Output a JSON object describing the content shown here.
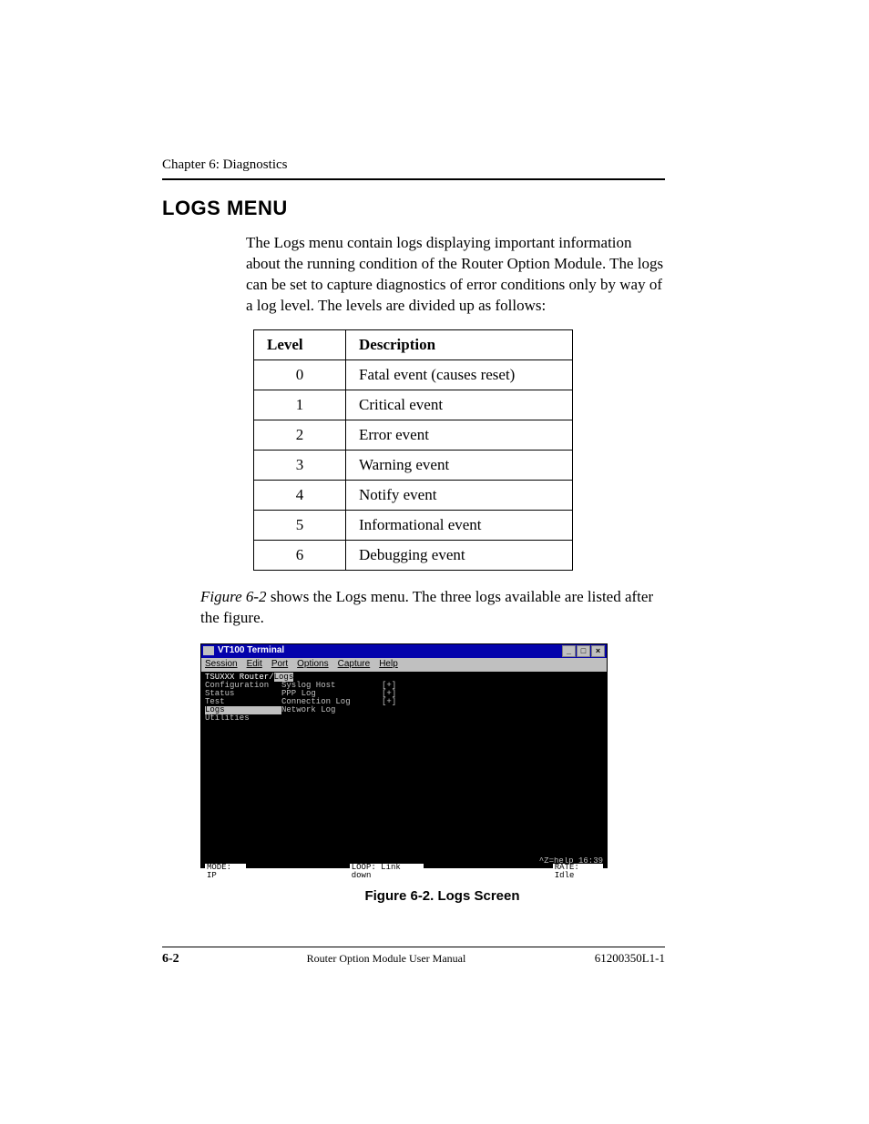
{
  "chapter_line": "Chapter 6:  Diagnostics",
  "section_title": "LOGS MENU",
  "intro_paragraph": "The Logs menu contain logs displaying important information about the running condition of the Router Option Module.  The logs can be set to capture diagnostics of error conditions only by way of a log level.  The levels are divided up as follows:",
  "table": {
    "headers": {
      "level": "Level",
      "description": "Description"
    },
    "rows": [
      {
        "level": "0",
        "description": "Fatal event (causes reset)"
      },
      {
        "level": "1",
        "description": "Critical event"
      },
      {
        "level": "2",
        "description": "Error event"
      },
      {
        "level": "3",
        "description": "Warning event"
      },
      {
        "level": "4",
        "description": "Notify event"
      },
      {
        "level": "5",
        "description": "Informational event"
      },
      {
        "level": "6",
        "description": "Debugging event"
      }
    ]
  },
  "figref_sentence_pre": "Figure 6-2",
  "figref_sentence_post": " shows the Logs menu. The three logs available are listed after the figure.",
  "terminal": {
    "title": "VT100 Terminal",
    "win_buttons": {
      "min": "_",
      "max": "□",
      "close": "×"
    },
    "menus": [
      "Session",
      "Edit",
      "Port",
      "Options",
      "Capture",
      "Help"
    ],
    "menu_underline_index": [
      0,
      0,
      0,
      0,
      0,
      0
    ],
    "path_prefix": "TSUXXX Router/",
    "path_highlight": "Logs",
    "left_items": [
      "Configuration",
      "Status",
      "Test",
      "Logs",
      "Utilities"
    ],
    "left_selected_index": 3,
    "right_items": [
      {
        "label": "Syslog Host",
        "marker": ""
      },
      {
        "label": "PPP Log",
        "marker": "[+]"
      },
      {
        "label": "Connection Log",
        "marker": "[+]"
      },
      {
        "label": "Network Log",
        "marker": "[+]"
      }
    ],
    "status": {
      "mode_label": "MODE:",
      "mode_value": "IP",
      "loop_label": "LOOP:",
      "loop_value": "Link down",
      "rate_label": "RATE:",
      "rate_value": "Idle"
    },
    "help_hint": "^Z=help 16:39"
  },
  "figure_caption": "Figure 6-2.  Logs Screen",
  "footer": {
    "page": "6-2",
    "manual": "Router Option Module User Manual",
    "docnum": "61200350L1-1"
  }
}
